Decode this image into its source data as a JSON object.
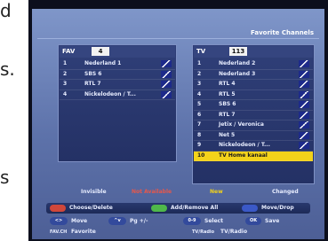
{
  "page": {
    "edge_letters": [
      "d",
      "s.",
      "s"
    ]
  },
  "header": {
    "title": "Favorite Channels"
  },
  "fav_panel": {
    "tag": "FAV",
    "number": "4",
    "rows": [
      {
        "n": "1",
        "name": "Nederland 1",
        "icon": true
      },
      {
        "n": "2",
        "name": "SBS 6",
        "icon": true
      },
      {
        "n": "3",
        "name": "RTL 7",
        "icon": true
      },
      {
        "n": "4",
        "name": "Nickelodeon / T...",
        "icon": true
      }
    ]
  },
  "tv_panel": {
    "tag": "TV",
    "number": "113",
    "rows": [
      {
        "n": "1",
        "name": "Nederland 2",
        "icon": true
      },
      {
        "n": "2",
        "name": "Nederland 3",
        "icon": true
      },
      {
        "n": "3",
        "name": "RTL 4",
        "icon": true
      },
      {
        "n": "4",
        "name": "RTL 5",
        "icon": true
      },
      {
        "n": "5",
        "name": "SBS 6",
        "icon": true
      },
      {
        "n": "6",
        "name": "RTL 7",
        "icon": true
      },
      {
        "n": "7",
        "name": "Jetix / Veronica",
        "icon": true
      },
      {
        "n": "8",
        "name": "Net 5",
        "icon": true
      },
      {
        "n": "9",
        "name": "Nickelodeon / T...",
        "icon": true
      },
      {
        "n": "10",
        "name": "TV Home kanaal",
        "icon": false
      }
    ],
    "selected_index": 9
  },
  "legend": {
    "invisible": "Invisible",
    "not_available": "Not Available",
    "new": "New",
    "changed": "Changed"
  },
  "buttons": {
    "choose_delete": "Choose/Delete",
    "add_remove_all": "Add/Remove All",
    "move_drop": "Move/Drop"
  },
  "hints": {
    "move_key": "<>",
    "move_label": "Move",
    "page_key": "^v",
    "page_label": "Pg +/-",
    "select_key": "0-9",
    "select_label": "Select",
    "ok_key": "OK",
    "save_label": "Save",
    "favch": "FAV.CH",
    "favorite": "Favorite",
    "tvradio_key": "TV/Radio",
    "tvradio_label": "TV/Radio"
  },
  "colors": {
    "red": "#d0473a",
    "green": "#4fb84a",
    "blue": "#3b59c7",
    "highlight": "#f3d21a"
  }
}
